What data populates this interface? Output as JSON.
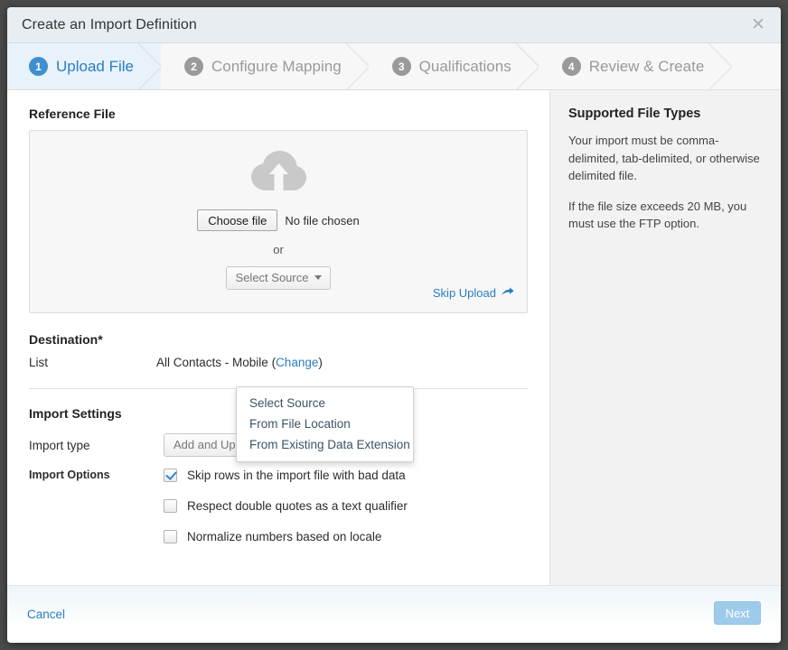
{
  "window": {
    "title": "Create an Import Definition",
    "close_icon": "close-icon"
  },
  "steps": [
    {
      "number": "1",
      "label": "Upload File",
      "state": "active"
    },
    {
      "number": "2",
      "label": "Configure Mapping",
      "state": "inactive"
    },
    {
      "number": "3",
      "label": "Qualifications",
      "state": "inactive"
    },
    {
      "number": "4",
      "label": "Review & Create",
      "state": "inactive"
    }
  ],
  "main": {
    "reference_file": {
      "label": "Reference File",
      "cloud_icon": "cloud-upload-icon",
      "choose_file_button": "Choose file",
      "no_file_text": "No file chosen",
      "or_text": "or",
      "select_source_button": "Select Source",
      "skip_upload_link": "Skip Upload",
      "skip_upload_icon": "arrow-forward-icon"
    },
    "source_menu": {
      "open": true,
      "items": [
        "Select Source",
        "From File Location",
        "From Existing Data Extension"
      ]
    },
    "destination": {
      "heading": "Destination*",
      "list_label": "List",
      "list_value": "All Contacts - Mobile",
      "change_link": "Change",
      "open_paren": "(",
      "close_paren": ")"
    },
    "import_settings": {
      "heading": "Import Settings",
      "import_type_label": "Import type",
      "import_type_value": "Add and Update",
      "import_options_label": "Import Options",
      "options": [
        {
          "label": "Skip rows in the import file with bad data",
          "checked": true
        },
        {
          "label": "Respect double quotes as a text qualifier",
          "checked": false
        },
        {
          "label": "Normalize numbers based on locale",
          "checked": false
        }
      ]
    }
  },
  "aside": {
    "heading": "Supported File Types",
    "paragraph_1": "Your import must be comma-delimited, tab-delimited, or otherwise delimited file.",
    "paragraph_2": "If the file size exceeds 20 MB, you must use the FTP option."
  },
  "footer": {
    "cancel_label": "Cancel",
    "next_label": "Next"
  },
  "colors": {
    "accent_blue": "#2a7ec1",
    "step_active_bg": "#e8f2fb",
    "step_active_badge": "#3f8fd0",
    "next_button_bg": "#9ecbea",
    "checkbox_check": "#2f86d4"
  }
}
